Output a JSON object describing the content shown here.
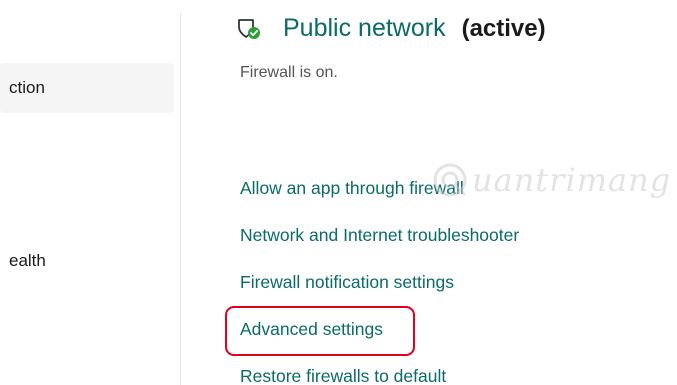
{
  "sidebar": {
    "items": [
      {
        "label": "ction"
      },
      {
        "label": "ealth"
      }
    ]
  },
  "network": {
    "title": "Public network",
    "status": "(active)",
    "firewall_status": "Firewall is on."
  },
  "links": [
    {
      "label": "Allow an app through firewall"
    },
    {
      "label": "Network and Internet troubleshooter"
    },
    {
      "label": "Firewall notification settings"
    },
    {
      "label": "Advanced settings"
    },
    {
      "label": "Restore firewalls to default"
    }
  ],
  "watermark": {
    "text": "uantrimang"
  },
  "colors": {
    "link": "#0b6a6a",
    "highlight": "#e3001b",
    "shield_check": "#2e9d3a"
  },
  "icons": {
    "network": "shield-check-icon",
    "watermark": "watermark-logo-icon"
  }
}
